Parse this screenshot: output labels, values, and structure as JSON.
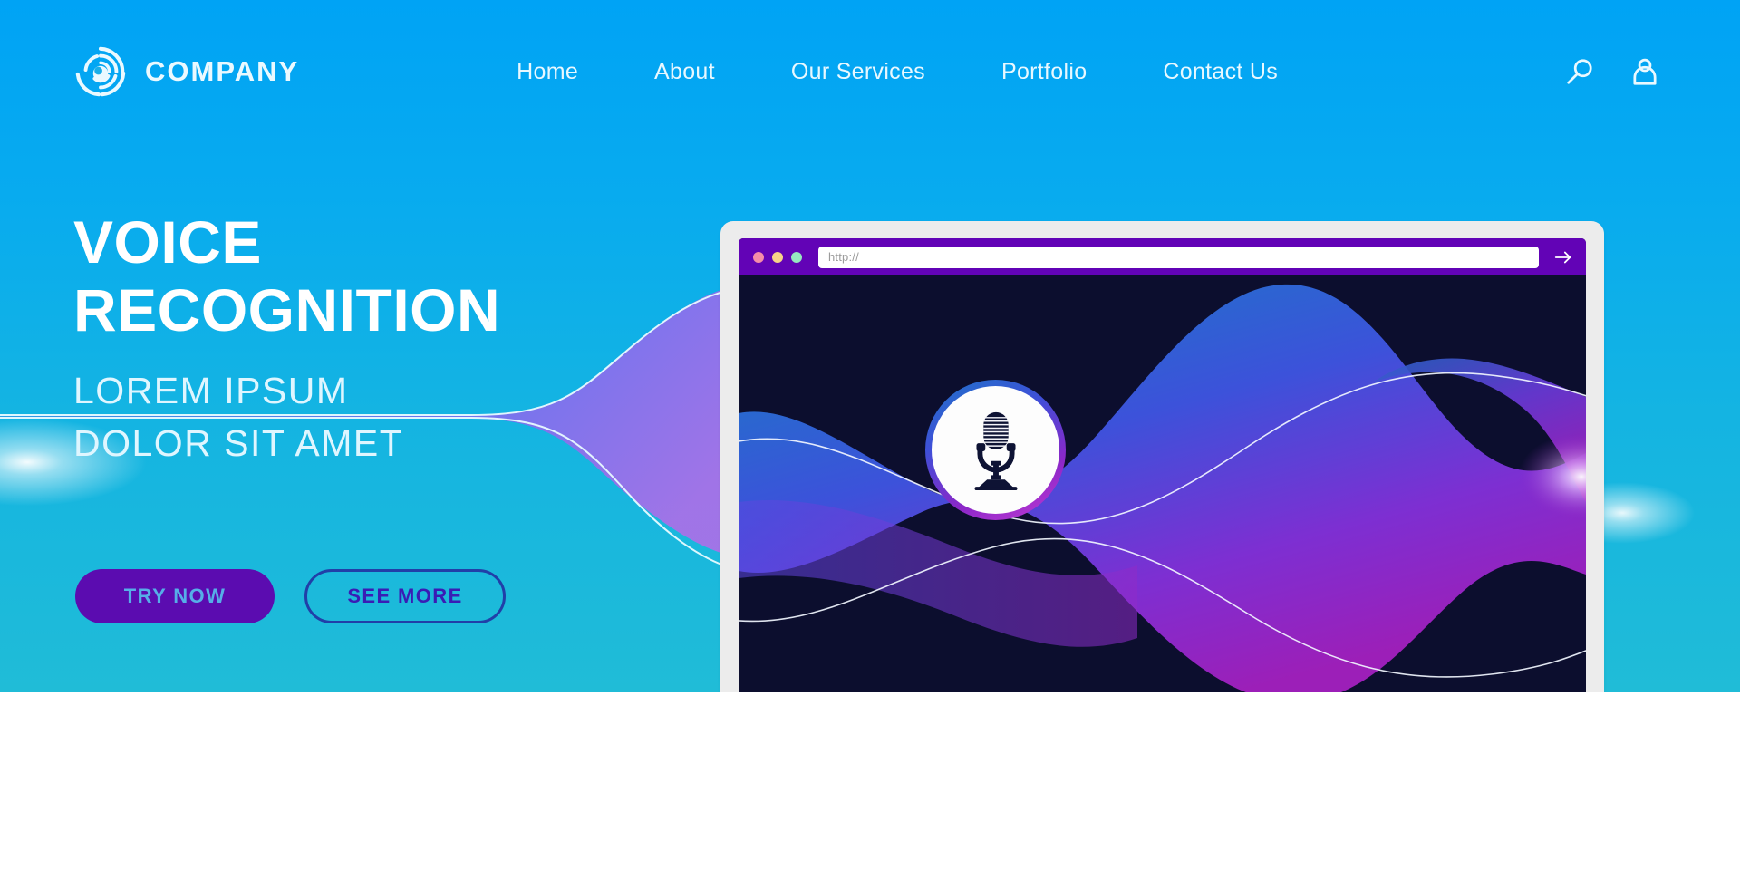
{
  "brand": {
    "name": "COMPANY",
    "logo_icon": "swirl-circle-logo"
  },
  "nav": {
    "links": [
      {
        "label": "Home"
      },
      {
        "label": "About"
      },
      {
        "label": "Our Services"
      },
      {
        "label": "Portfolio"
      },
      {
        "label": "Contact Us"
      }
    ],
    "icons": [
      {
        "name": "search-icon"
      },
      {
        "name": "user-account-icon"
      }
    ]
  },
  "hero": {
    "headline_line1": "VOICE",
    "headline_line2": "RECOGNITION",
    "subhead_line1": "LOREM IPSUM",
    "subhead_line2": "DOLOR SIT AMET",
    "primary_cta": "TRY NOW",
    "secondary_cta": "SEE MORE"
  },
  "browser": {
    "url_placeholder": "http://",
    "url_value": "",
    "go_icon": "arrow-right-icon",
    "traffic_lights": [
      {
        "name": "close-dot",
        "color": "#F58DA8"
      },
      {
        "name": "minimize-dot",
        "color": "#F7D488"
      },
      {
        "name": "maximize-dot",
        "color": "#96E8C0"
      }
    ]
  },
  "screen": {
    "mic_icon": "microphone-icon",
    "visual": "voice-waveform-illustration"
  },
  "colors": {
    "hero_top": "#00A3F5",
    "hero_bottom": "#20BCD7",
    "brand_purple": "#5B0CB0",
    "browser_bar": "#6203B6",
    "screen_dark": "#0C0E2E",
    "outline_blue": "#213FA8",
    "primary_cta_text": "#56AEE8",
    "secondary_cta_text": "#3A1CB5"
  }
}
